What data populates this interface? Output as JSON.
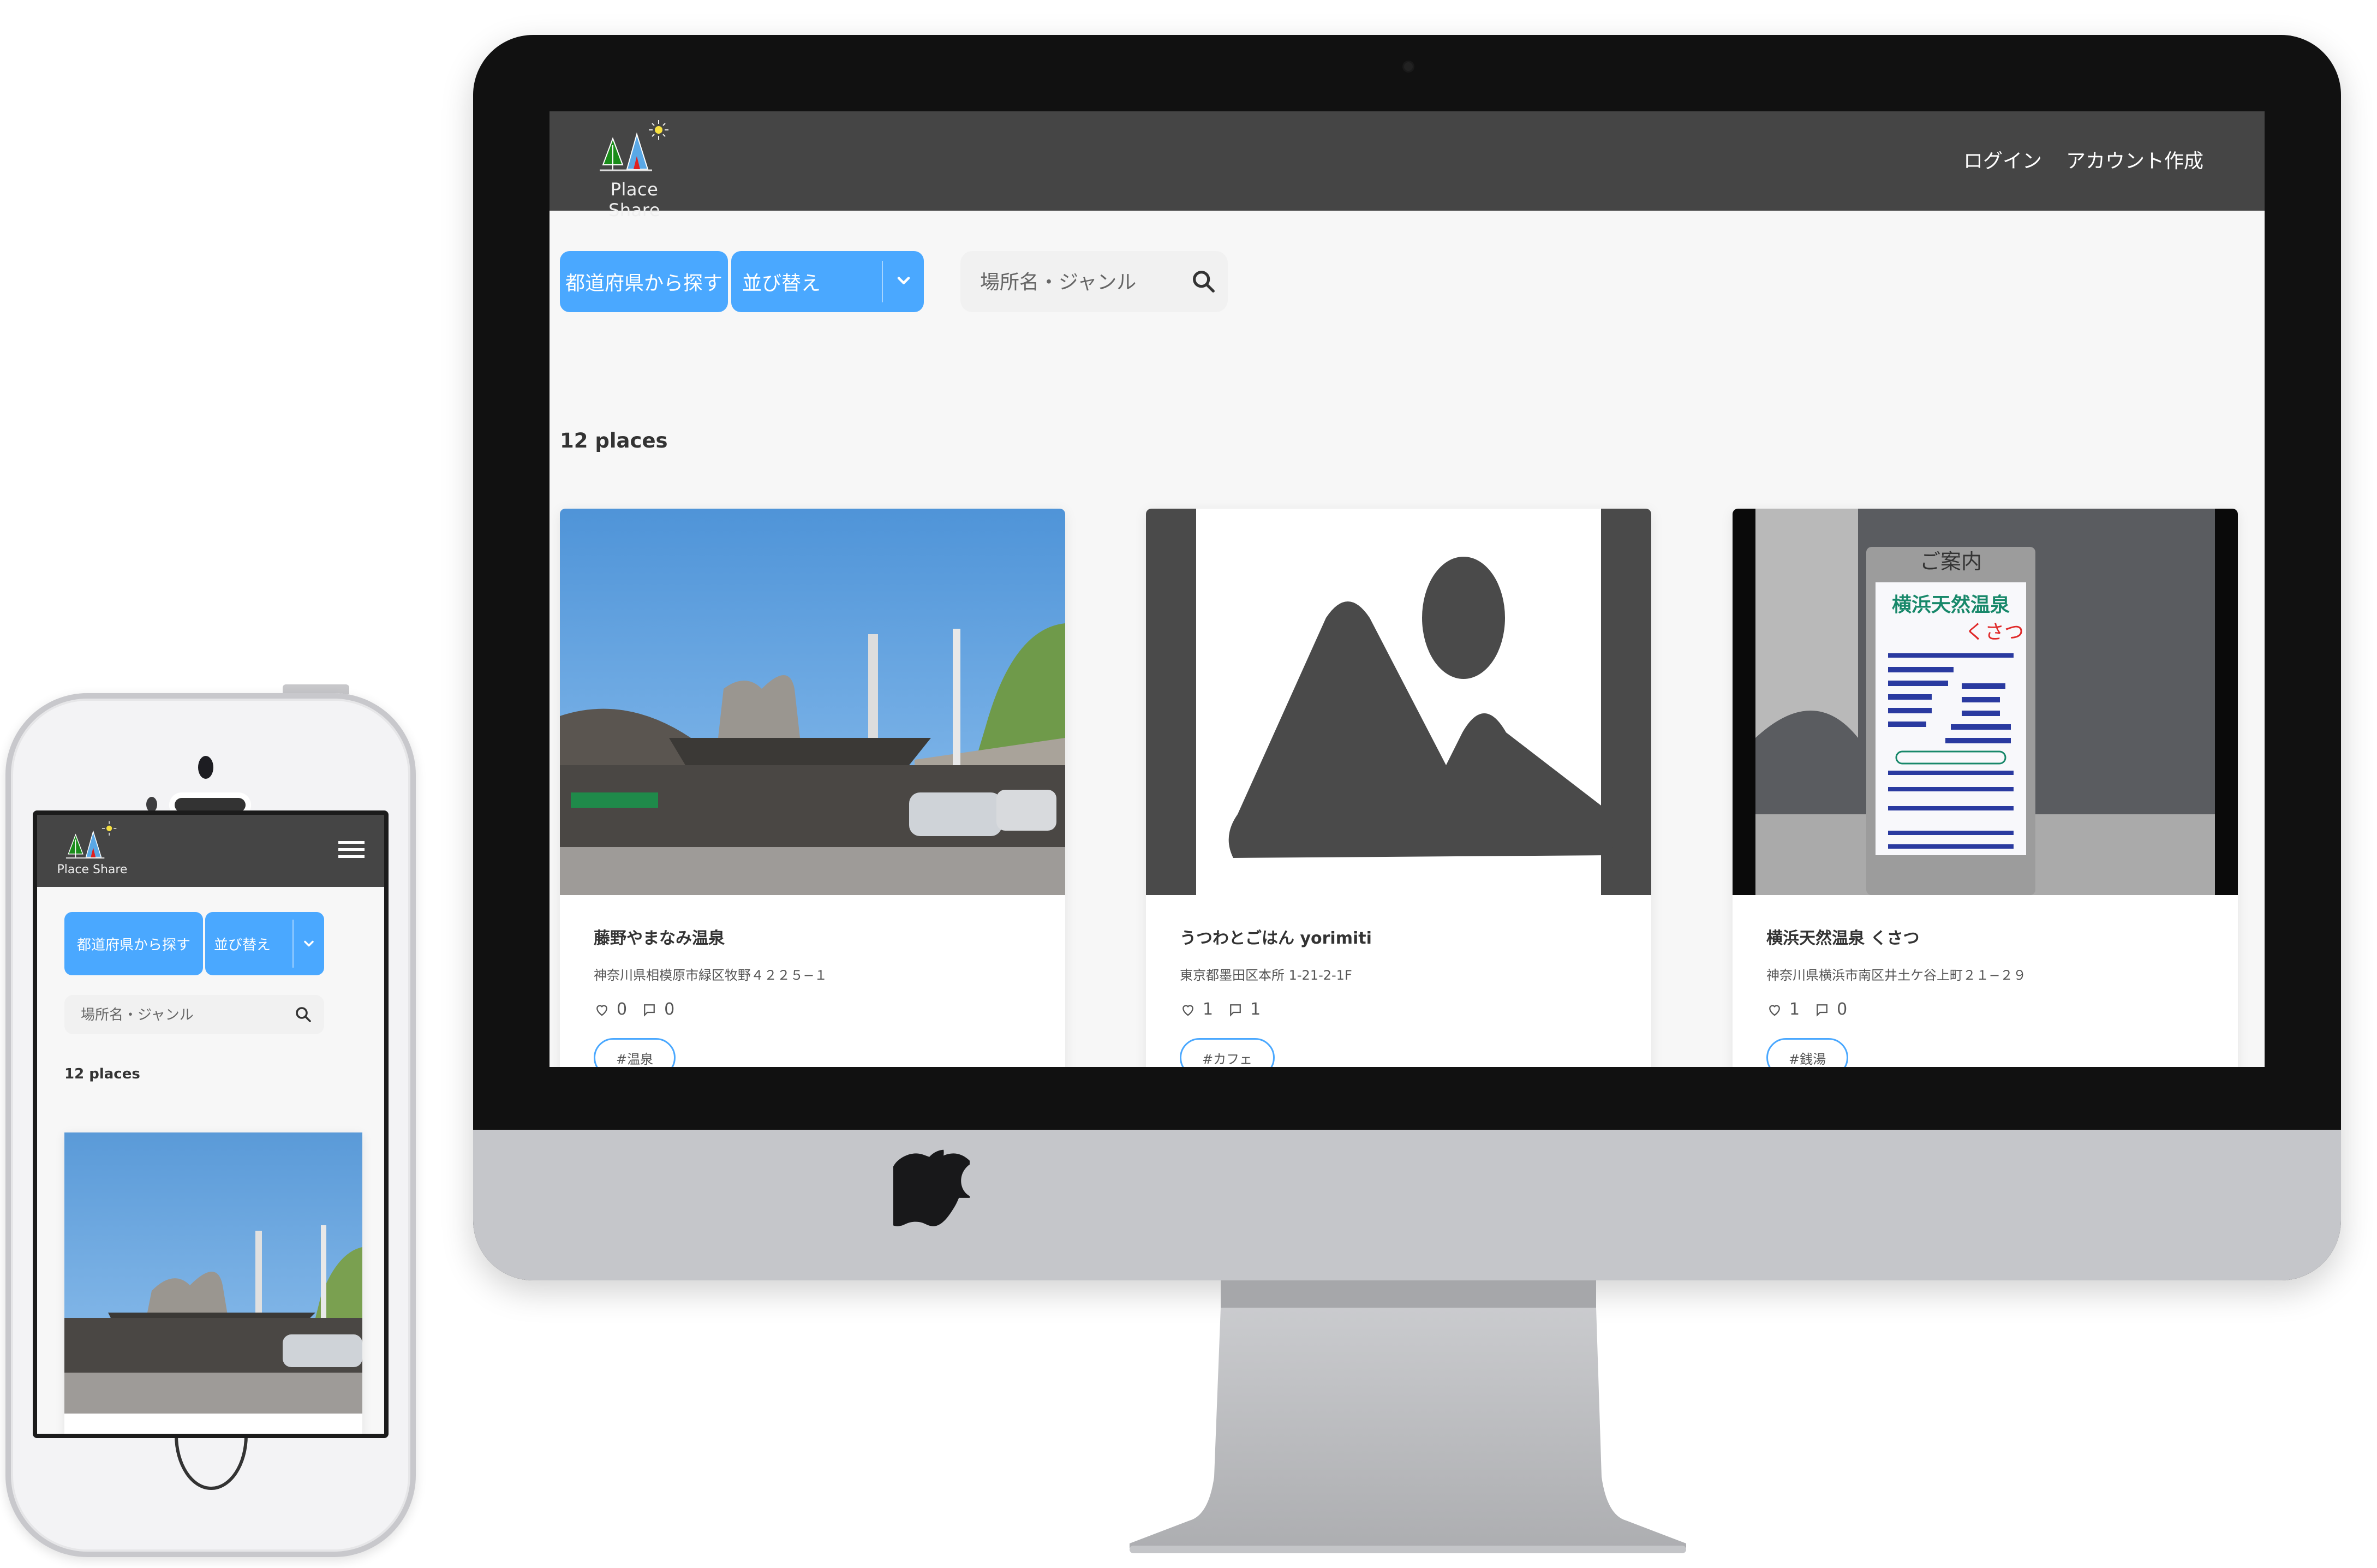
{
  "app": {
    "name": "Place Share",
    "brand_color": "#4aa8ff",
    "header_color": "#454545"
  },
  "header": {
    "logo_text": "Place Share",
    "nav": [
      {
        "label": "ログイン"
      },
      {
        "label": "アカウント作成"
      }
    ],
    "menu_icon": "hamburger-icon"
  },
  "filters": {
    "prefecture_button": "都道府県から探す",
    "sort_button": "並び替え",
    "sort_icon": "chevron-down-icon",
    "search": {
      "placeholder": "場所名・ジャンル",
      "value": "",
      "icon": "search-icon"
    }
  },
  "results": {
    "count_label": "12 places"
  },
  "places": [
    {
      "title": "藤野やまなみ温泉",
      "address": "神奈川県相模原市緑区牧野４２２５−１",
      "likes": "0",
      "comments": "0",
      "tag": "#温泉",
      "image": "hot-spring-building-photo"
    },
    {
      "title": "うつわとごはん yorimiti",
      "address": "東京都墨田区本所 1-21-2-1F",
      "likes": "1",
      "comments": "1",
      "tag": "#カフェ",
      "image": "placeholder-image-icon"
    },
    {
      "title": "横浜天然温泉 くさつ",
      "address": "神奈川県横浜市南区井土ケ谷上町２１−２９",
      "likes": "1",
      "comments": "0",
      "tag": "#銭湯",
      "image": "signboard-photo",
      "sign": {
        "header": "ご案内",
        "name": "横浜天然温泉",
        "name2": "くさつ"
      }
    }
  ],
  "devices": {
    "desktop": "imac",
    "mobile": "iphone"
  }
}
